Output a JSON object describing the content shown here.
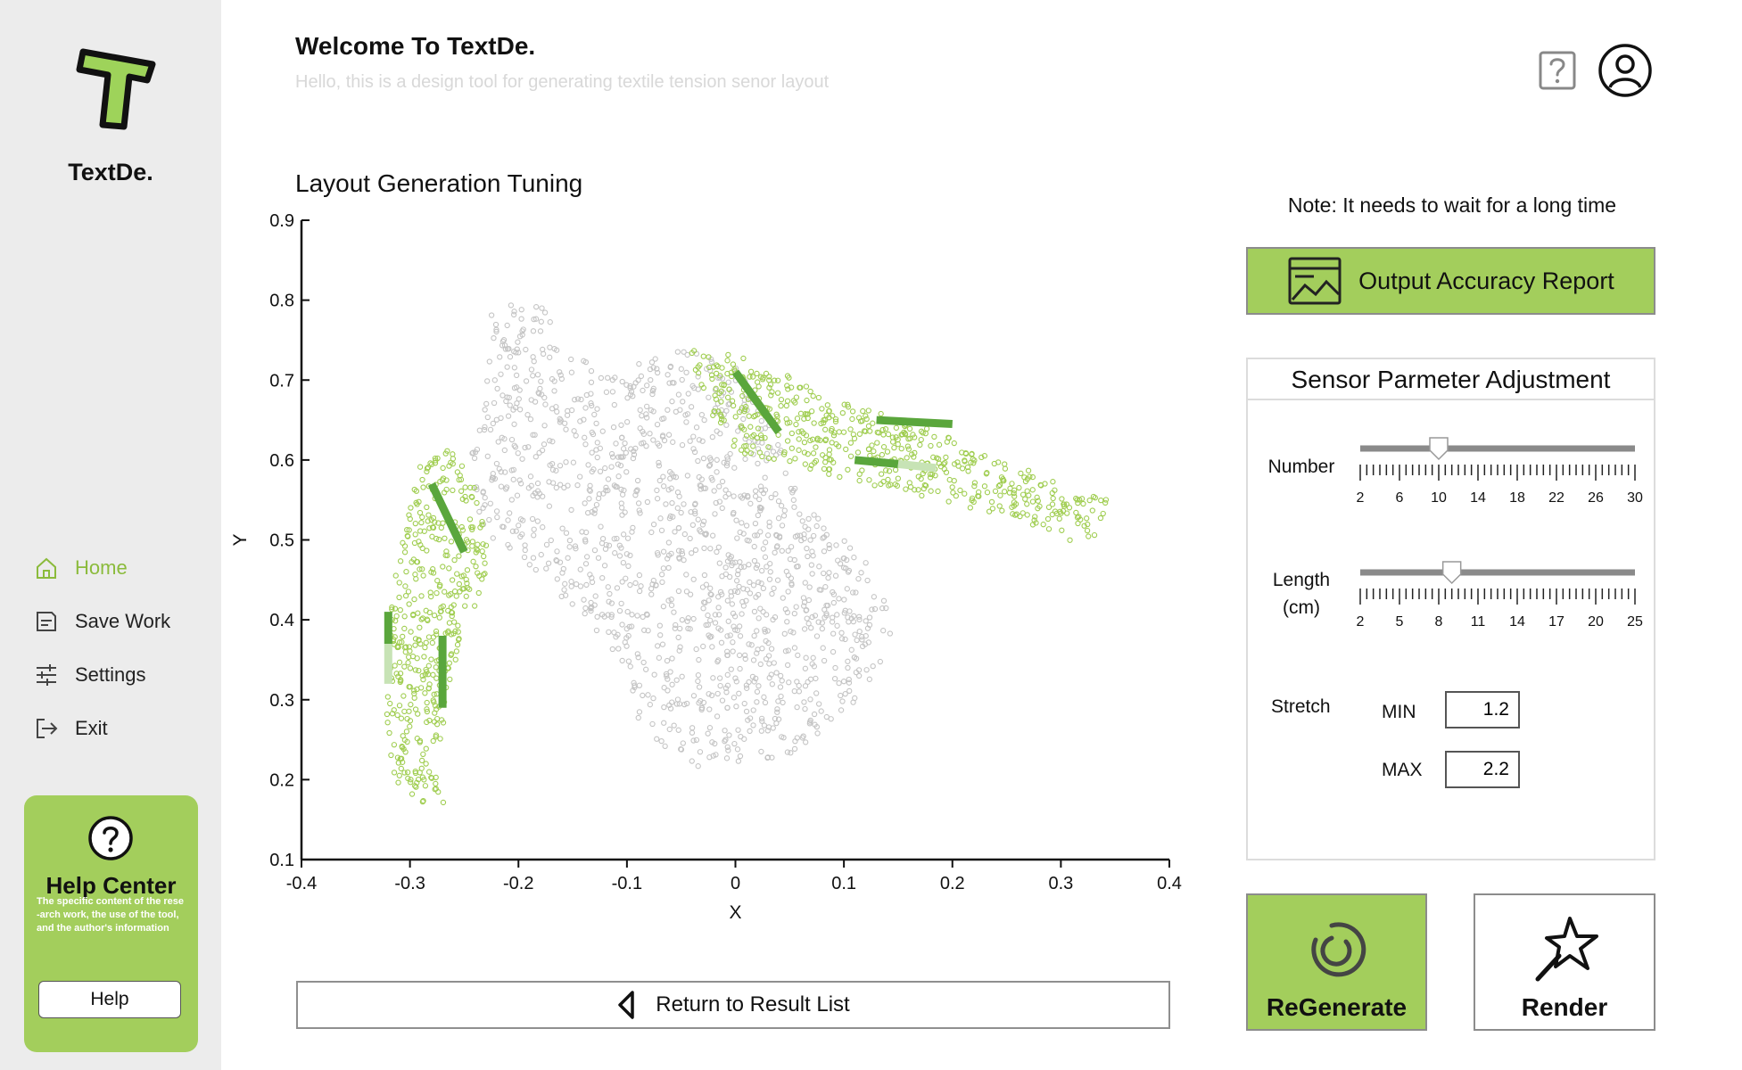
{
  "brand": {
    "name": "TextDe."
  },
  "nav": {
    "items": [
      {
        "label": "Home",
        "icon": "home-icon",
        "active": true
      },
      {
        "label": "Save Work",
        "icon": "save-icon",
        "active": false
      },
      {
        "label": "Settings",
        "icon": "sliders-icon",
        "active": false
      },
      {
        "label": "Exit",
        "icon": "exit-icon",
        "active": false
      }
    ]
  },
  "help_center": {
    "title": "Help Center",
    "description": "The specific content of the rese -arch work, the use of the tool, and the author's information",
    "button": "Help"
  },
  "header": {
    "welcome": "Welcome To TextDe.",
    "subtitle": "Hello, this is a design tool for generating textile tension senor layout"
  },
  "chart_title": "Layout Generation Tuning",
  "chart_data": {
    "type": "scatter",
    "xlabel": "X",
    "ylabel": "Y",
    "xlim": [
      -0.4,
      0.4
    ],
    "ylim": [
      0.1,
      0.9
    ],
    "xticks": [
      "-0.4",
      "-0.3",
      "-0.2",
      "-0.1",
      "0",
      "0.1",
      "0.2",
      "0.3",
      "0.4"
    ],
    "yticks": [
      "0.1",
      "0.2",
      "0.3",
      "0.4",
      "0.5",
      "0.6",
      "0.7",
      "0.8",
      "0.9"
    ],
    "grid": false,
    "colors": {
      "body_points": "#c4c4c4",
      "arm_points": "#9fcd4f",
      "sensor": "#5aa63c",
      "sensor_light": "#c7e3b5"
    },
    "sensors": [
      {
        "x1": 0.0,
        "y1": 0.71,
        "x2": 0.04,
        "y2": 0.635
      },
      {
        "x1": 0.13,
        "y1": 0.65,
        "x2": 0.2,
        "y2": 0.645
      },
      {
        "x1": 0.11,
        "y1": 0.6,
        "x2": 0.15,
        "y2": 0.595
      },
      {
        "x1": 0.15,
        "y1": 0.595,
        "x2": 0.185,
        "y2": 0.59,
        "light": true
      },
      {
        "x1": -0.28,
        "y1": 0.57,
        "x2": -0.25,
        "y2": 0.485
      },
      {
        "x1": -0.32,
        "y1": 0.41,
        "x2": -0.32,
        "y2": 0.37
      },
      {
        "x1": -0.32,
        "y1": 0.37,
        "x2": -0.32,
        "y2": 0.32,
        "light": true
      },
      {
        "x1": -0.27,
        "y1": 0.38,
        "x2": -0.27,
        "y2": 0.29
      }
    ]
  },
  "return_button": "Return to Result List",
  "note": "Note: It needs to wait for a long time",
  "report_button": "Output Accuracy Report",
  "params": {
    "title": "Sensor Parmeter Adjustment",
    "number": {
      "label": "Number",
      "ticks": [
        "2",
        "6",
        "10",
        "14",
        "18",
        "22",
        "26",
        "30"
      ],
      "min": 2,
      "max": 30,
      "value": 10
    },
    "length": {
      "label_line1": "Length",
      "label_line2": "(cm)",
      "ticks": [
        "2",
        "5",
        "8",
        "11",
        "14",
        "17",
        "20",
        "25"
      ],
      "min": 2,
      "max": 25,
      "value": 9
    },
    "stretch": {
      "label": "Stretch",
      "min_label": "MIN",
      "min_value": "1.2",
      "max_label": "MAX",
      "max_value": "2.2"
    }
  },
  "buttons": {
    "regenerate": "ReGenerate",
    "render": "Render"
  }
}
